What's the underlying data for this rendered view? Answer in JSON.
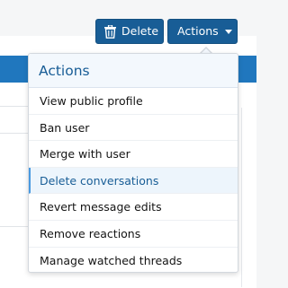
{
  "toolbar": {
    "delete_label": "Delete",
    "actions_label": "Actions"
  },
  "menu": {
    "title": "Actions",
    "items": [
      {
        "label": "View public profile"
      },
      {
        "label": "Ban user"
      },
      {
        "label": "Merge with user"
      },
      {
        "label": "Delete conversations"
      },
      {
        "label": "Revert message edits"
      },
      {
        "label": "Remove reactions"
      },
      {
        "label": "Manage watched threads"
      }
    ]
  },
  "icons": {
    "delete": "trash-icon",
    "actions": "caret-down-icon"
  },
  "colors": {
    "button_bg": "#185d96",
    "header_text": "#185d96",
    "header_bg": "#f3f8fd",
    "active_item_bg": "#edf5fc"
  }
}
